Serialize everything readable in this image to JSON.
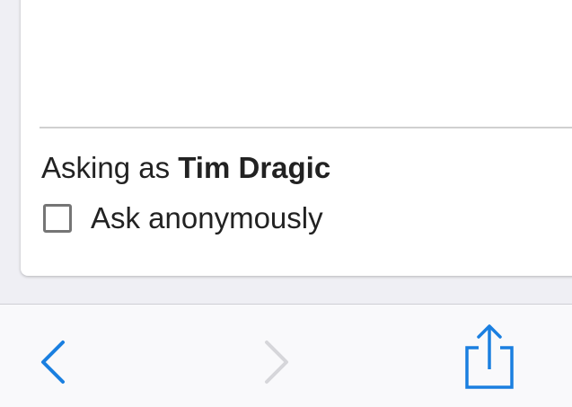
{
  "compose": {
    "asking_prefix": "Asking as ",
    "user_name": "Tim Dragic",
    "anonymous_label": "Ask anonymously",
    "anonymous_checked": false
  },
  "toolbar": {
    "back_icon": "chevron-left-icon",
    "forward_icon": "chevron-right-icon",
    "share_icon": "share-icon",
    "back_enabled": true,
    "forward_enabled": false
  },
  "colors": {
    "accent": "#1a7fe0",
    "disabled": "#d6d6da",
    "text": "#222222",
    "checkbox_border": "#757575"
  }
}
